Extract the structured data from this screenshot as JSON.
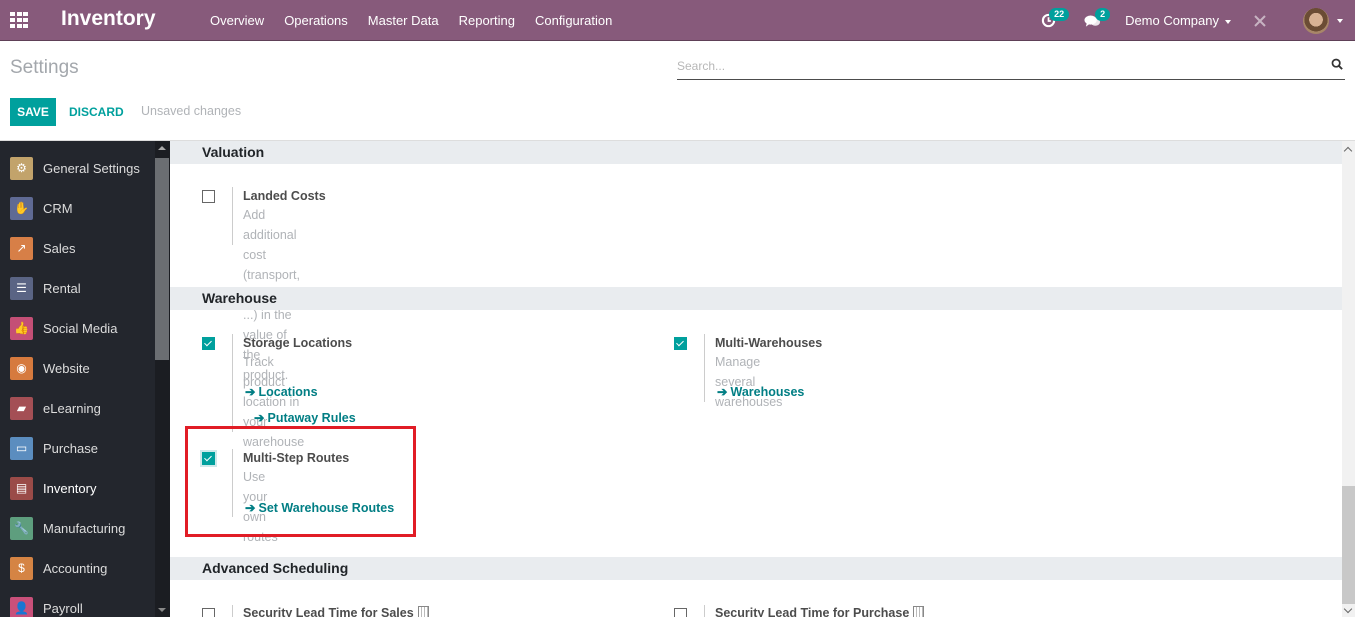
{
  "navbar": {
    "app_title": "Inventory",
    "menu": [
      "Overview",
      "Operations",
      "Master Data",
      "Reporting",
      "Configuration"
    ],
    "activity_count": "22",
    "messages_count": "2",
    "company": "Demo Company",
    "accent_color": "#875a7b"
  },
  "control_panel": {
    "title": "Settings",
    "search_placeholder": "Search...",
    "save_label": "SAVE",
    "discard_label": "DISCARD",
    "status": "Unsaved changes"
  },
  "sidebar": {
    "items": [
      {
        "label": "General Settings",
        "icon": "gear-icon",
        "color": "#c2a36b"
      },
      {
        "label": "CRM",
        "icon": "handshake-icon",
        "color": "#5f6a94"
      },
      {
        "label": "Sales",
        "icon": "chart-line-icon",
        "color": "#d77f47"
      },
      {
        "label": "Rental",
        "icon": "rental-icon",
        "color": "#5a6484"
      },
      {
        "label": "Social Media",
        "icon": "thumbs-up-icon",
        "color": "#c44f76"
      },
      {
        "label": "Website",
        "icon": "globe-icon",
        "color": "#d67a3e"
      },
      {
        "label": "eLearning",
        "icon": "elearning-icon",
        "color": "#a44f55"
      },
      {
        "label": "Purchase",
        "icon": "credit-card-icon",
        "color": "#5b8dbf"
      },
      {
        "label": "Inventory",
        "icon": "box-icon",
        "color": "#9a4b48",
        "active": true
      },
      {
        "label": "Manufacturing",
        "icon": "wrench-icon",
        "color": "#5e9e7e"
      },
      {
        "label": "Accounting",
        "icon": "invoice-icon",
        "color": "#d58444"
      },
      {
        "label": "Payroll",
        "icon": "payroll-icon",
        "color": "#c9507a"
      }
    ]
  },
  "sections": {
    "valuation": {
      "title": "Valuation",
      "landed_costs": {
        "title": "Landed Costs",
        "desc_line1": "Add additional cost (transport, customs, ...) in the value of the",
        "desc_line2": "product.",
        "checked": false
      }
    },
    "warehouse": {
      "title": "Warehouse",
      "storage_locations": {
        "title": "Storage Locations",
        "desc": "Track product location in your warehouse",
        "checked": true,
        "links": [
          "Locations",
          "Putaway Rules"
        ]
      },
      "multi_warehouses": {
        "title": "Multi-Warehouses",
        "desc": "Manage several warehouses",
        "checked": true,
        "links": [
          "Warehouses"
        ]
      },
      "multi_step_routes": {
        "title": "Multi-Step Routes",
        "desc": "Use your own routes",
        "checked": true,
        "links": [
          "Set Warehouse Routes"
        ]
      }
    },
    "advanced_scheduling": {
      "title": "Advanced Scheduling",
      "sales_lead": {
        "title": "Security Lead Time for Sales",
        "checked": false
      },
      "purchase_lead": {
        "title": "Security Lead Time for Purchase",
        "checked": false
      }
    }
  }
}
